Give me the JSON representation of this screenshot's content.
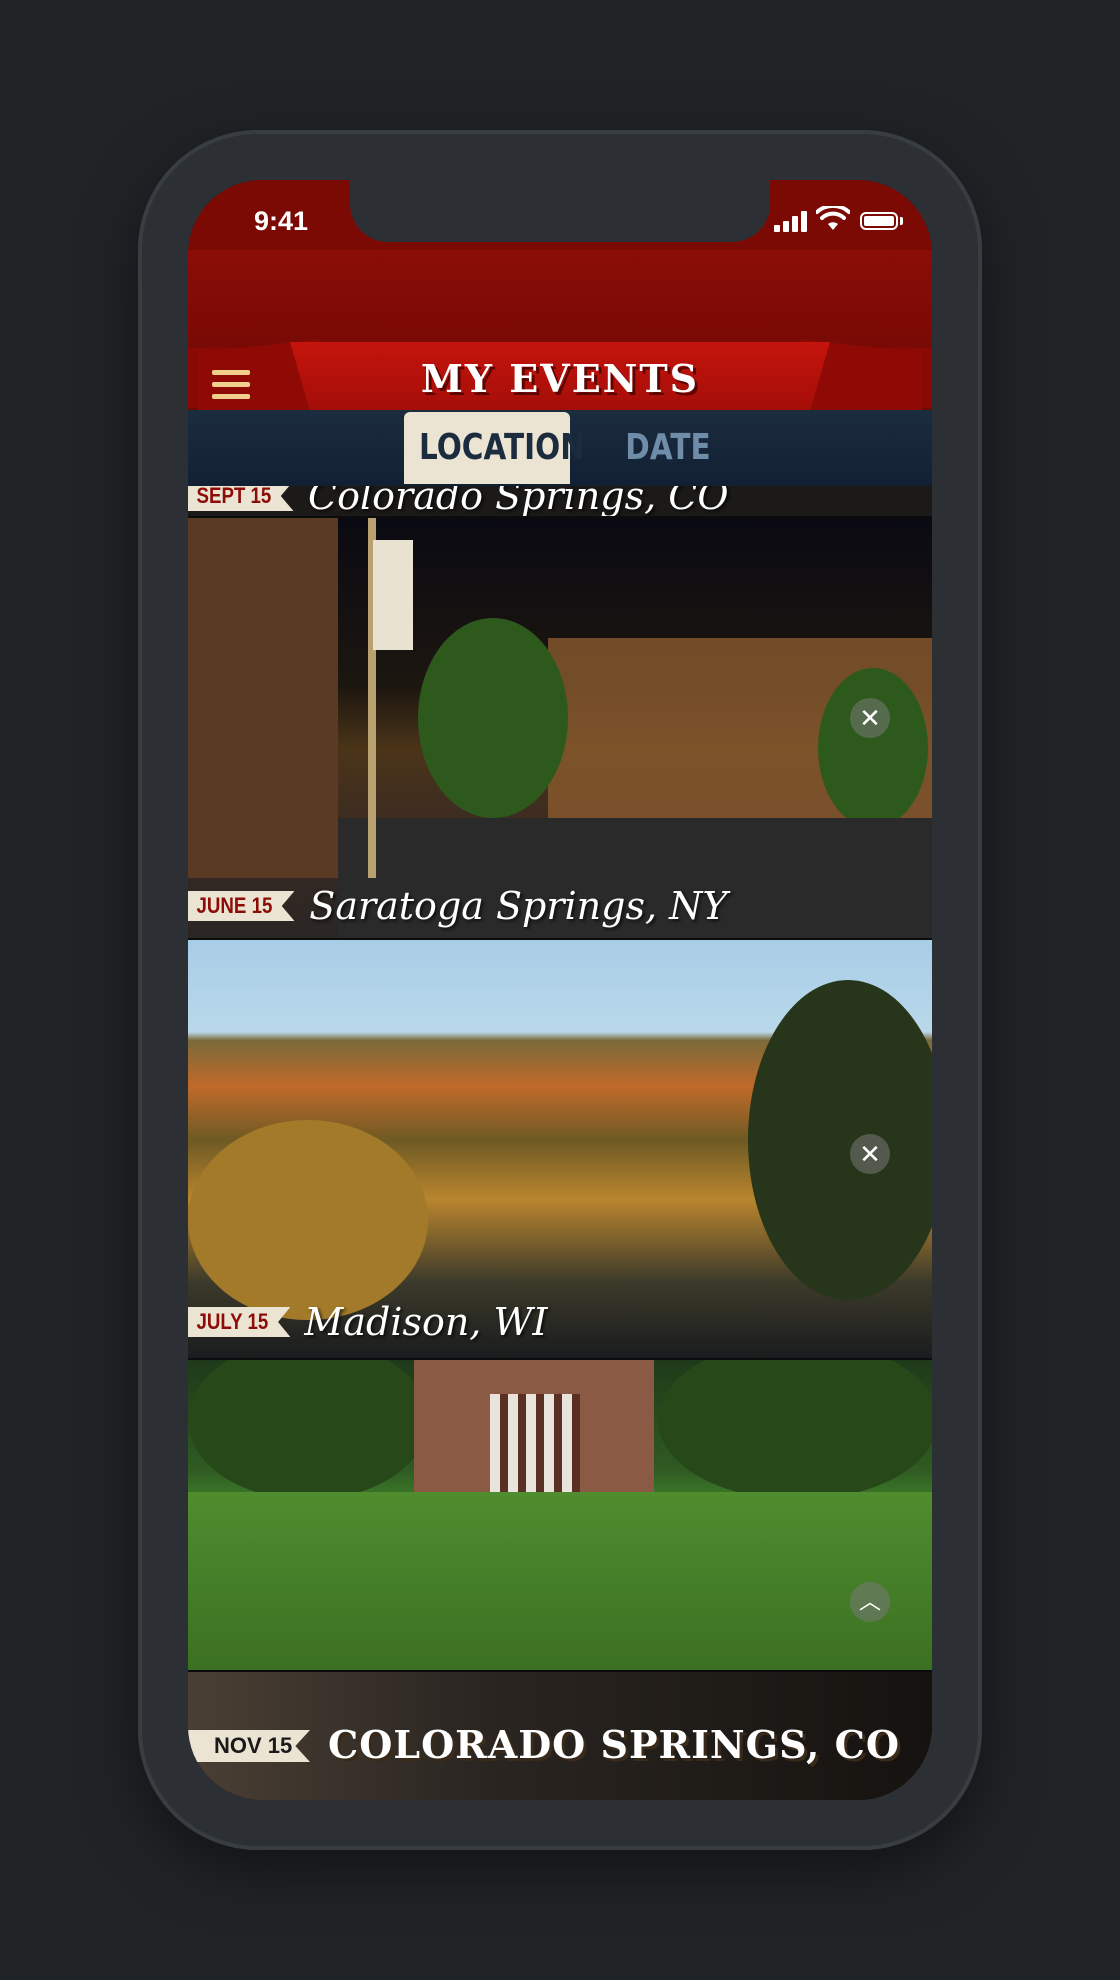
{
  "status_bar": {
    "time": "9:41"
  },
  "header": {
    "title": "MY EVENTS",
    "menu_icon": "hamburger-menu-icon"
  },
  "tabs": [
    {
      "label": "LOCATION",
      "active": true
    },
    {
      "label": "DATE",
      "active": false
    }
  ],
  "events": [
    {
      "date": "SEPT 15",
      "place": "Colorado Springs, CO"
    },
    {
      "date": "JUNE 15",
      "place": "Saratoga Springs, NY"
    },
    {
      "date": "JULY 15",
      "place": "Madison, WI"
    },
    {
      "date": "NOV 15",
      "place": "COLORADO SPRINGS, CO"
    }
  ],
  "colors": {
    "header_red": "#8b0d07",
    "ribbon_red": "#c4140c",
    "tab_navy": "#1c2c3f",
    "tab_active_bg": "#ece4d2",
    "menu_gold": "#f1cf8c"
  }
}
